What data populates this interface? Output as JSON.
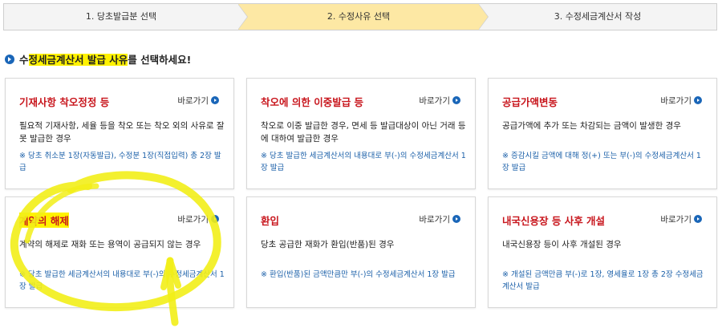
{
  "steps": [
    {
      "label": "1. 당초발급분 선택"
    },
    {
      "label": "2. 수정사유 선택"
    },
    {
      "label": "3. 수정세금계산서 작성"
    }
  ],
  "heading": {
    "prefix": "수",
    "highlight": "정세금계산서 발급 사유",
    "suffix": "를 선택하세요!"
  },
  "goto_label": "바로가기",
  "cards": [
    {
      "title": "기재사항 착오정정 등",
      "desc": "필요적 기재사항, 세율 등을 착오 또는 착오 외의 사유로 잘못 발급한 경우",
      "note": "※ 당초 취소분 1장(자동발급), 수정분 1장(직접입력) 총 2장 발급"
    },
    {
      "title": "착오에 의한 이중발급 등",
      "desc": "착오로 이중 발급한 경우, 면세 등 발급대상이 아닌 거래 등에 대하여 발급한 경우",
      "note": "※ 당초 발급한 세금계산서의 내용대로 부(-)의 수정세금계산서 1장 발급"
    },
    {
      "title": "공급가액변동",
      "desc": "공급가액에 추가 또는 차감되는 금액이 발생한 경우",
      "note": "※ 증감시킬 금액에 대해 정(+) 또는 부(-)의 수정세금계산서 1장 발급"
    },
    {
      "title": "계약의 해제",
      "desc": "계약의 해제로 재화 또는 용역이 공급되지 않는 경우",
      "note": "※ 당초 발급한 세금계산서의 내용대로 부(-)의 수정세금계산서 1장 발급"
    },
    {
      "title": "환입",
      "desc": "당초 공급한 재화가 환입(반품)된 경우",
      "note": "※ 환입(반품)된 금액만큼만 부(-)의 수정세금계산서 1장 발급"
    },
    {
      "title": "내국신용장 등 사후 개설",
      "desc": "내국신용장 등이 사후 개설된 경우",
      "note": "※ 개설된 금액만큼 부(-)로 1장, 영세율로 1장 총 2장 수정세금계산서 발급"
    }
  ],
  "colors": {
    "title_red": "#c8161d",
    "note_blue": "#1a5fa8",
    "highlight_yellow": "#fff200",
    "active_step": "#fde8a4"
  }
}
